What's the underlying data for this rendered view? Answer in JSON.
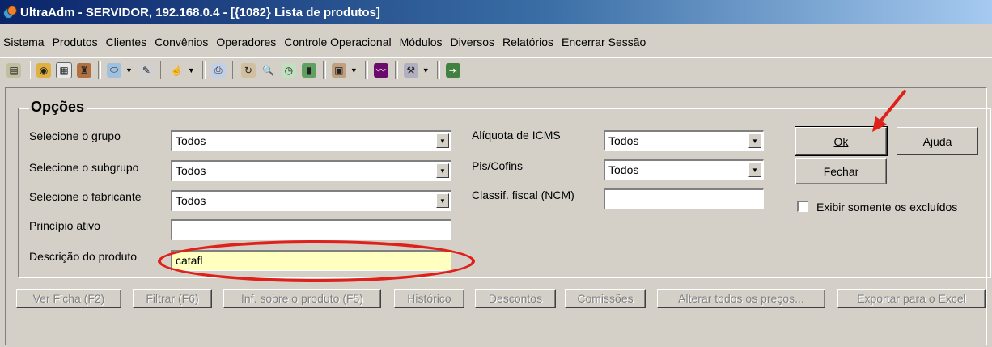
{
  "window": {
    "title": "UltraAdm - SERVIDOR, 192.168.0.4 - [{1082} Lista de produtos]"
  },
  "menu": [
    "Sistema",
    "Produtos",
    "Clientes",
    "Convênios",
    "Operadores",
    "Controle Operacional",
    "Módulos",
    "Diversos",
    "Relatórios",
    "Encerrar Sessão"
  ],
  "group": {
    "title": "Opções"
  },
  "fields": {
    "grupo": {
      "label": "Selecione o grupo",
      "value": "Todos"
    },
    "subgrupo": {
      "label": "Selecione o subgrupo",
      "value": "Todos"
    },
    "fabricante": {
      "label": "Selecione o fabricante",
      "value": "Todos"
    },
    "principio": {
      "label": "Princípio ativo",
      "value": ""
    },
    "descricao": {
      "label": "Descrição do produto",
      "value": "catafl"
    },
    "icms": {
      "label": "Alíquota de ICMS",
      "value": "Todos"
    },
    "pis": {
      "label": "Pis/Cofins",
      "value": "Todos"
    },
    "ncm": {
      "label": "Classif. fiscal (NCM)",
      "value": ""
    }
  },
  "buttons": {
    "ok": "Ok",
    "ajuda": "Ajuda",
    "fechar": "Fechar",
    "excluidos": "Exibir somente os excluídos"
  },
  "actions": [
    "Ver Ficha (F2)",
    "Filtrar (F6)",
    "Inf. sobre o produto (F5)",
    "Histórico",
    "Descontos",
    "Comissões",
    "Alterar todos os preços...",
    "Exportar para o Excel"
  ],
  "colors": {
    "annotation": "#e0201a",
    "highlight_field": "#ffffc0",
    "title_bar": "#0a246a"
  }
}
